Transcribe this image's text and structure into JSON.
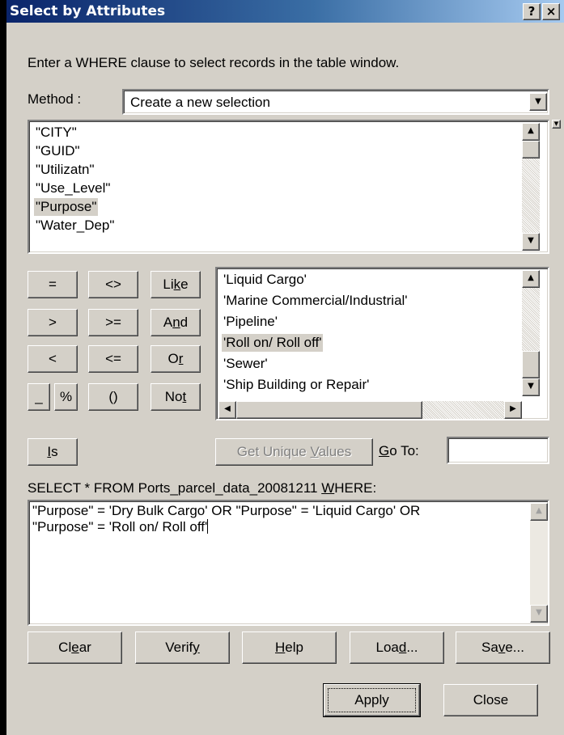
{
  "window": {
    "title": "Select by Attributes",
    "help_glyph": "?",
    "close_glyph": "×"
  },
  "instruction": "Enter a WHERE clause to select records in the table window.",
  "method": {
    "label": "Method :",
    "value": "Create a new selection"
  },
  "fields": [
    "\"CITY\"",
    "\"GUID\"",
    "\"Utilizatn\"",
    "\"Use_Level\"",
    "\"Purpose\"",
    "\"Water_Dep\""
  ],
  "fields_selected_index": 4,
  "operators": {
    "eq": "=",
    "neq": "<>",
    "like_pre": "Li",
    "like_u": "k",
    "like_post": "e",
    "gt": ">",
    "gte": ">=",
    "and_pre": "A",
    "and_u": "n",
    "and_post": "d",
    "lt": "<",
    "lte": "<=",
    "or_pre": "O",
    "or_u": "r",
    "underscore": "_",
    "percent": "%",
    "parens": "()",
    "not_pre": "No",
    "not_u": "t",
    "is_u": "I",
    "is_post": "s"
  },
  "values": [
    "'Liquid Cargo'",
    "'Marine Commercial/Industrial'",
    "'Pipeline'",
    "'Roll on/ Roll off'",
    "'Sewer'",
    "'Ship Building or Repair'"
  ],
  "values_selected_index": 3,
  "get_unique": {
    "pre": "Get Unique ",
    "u": "V",
    "post": "alues"
  },
  "goto": {
    "u": "G",
    "post": "o To:",
    "value": ""
  },
  "sql": {
    "pre": "SELECT * FROM Ports_parcel_data_20081211 ",
    "u": "W",
    "post": "HERE:",
    "line1": "\"Purpose\" = 'Dry Bulk Cargo' OR \"Purpose\" = 'Liquid Cargo' OR",
    "line2": "\"Purpose\" = 'Roll on/ Roll off'"
  },
  "buttons": {
    "clear": {
      "pre": "Cl",
      "u": "e",
      "post": "ar"
    },
    "verify": {
      "pre": "Verif",
      "u": "y",
      "post": ""
    },
    "help": {
      "pre": "",
      "u": "H",
      "post": "elp"
    },
    "load": {
      "pre": "Loa",
      "u": "d",
      "post": "..."
    },
    "save": {
      "pre": "Sa",
      "u": "v",
      "post": "e..."
    },
    "apply": "Apply",
    "close": "Close"
  },
  "icons": {
    "dropdown": "chevron-down-icon",
    "up": "arrow-up-icon",
    "down": "arrow-down-icon",
    "left": "arrow-left-icon",
    "right": "arrow-right-icon"
  }
}
